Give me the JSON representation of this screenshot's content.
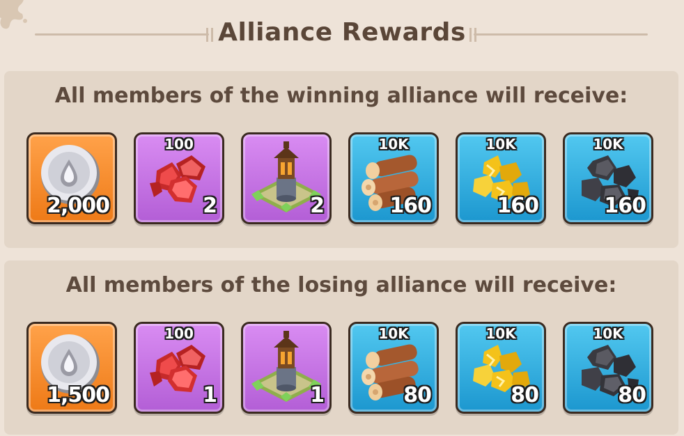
{
  "title": "Alliance Rewards",
  "winning": {
    "heading": "All members of the winning alliance will receive:",
    "rewards": [
      {
        "icon": "silver-coin-icon",
        "badge": "",
        "amount": "2,000"
      },
      {
        "icon": "red-gems-icon",
        "badge": "100",
        "amount": "2"
      },
      {
        "icon": "watchtower-icon",
        "badge": "",
        "amount": "2"
      },
      {
        "icon": "wood-logs-icon",
        "badge": "10K",
        "amount": "160"
      },
      {
        "icon": "gold-ore-icon",
        "badge": "10K",
        "amount": "160"
      },
      {
        "icon": "coal-ore-icon",
        "badge": "10K",
        "amount": "160"
      }
    ]
  },
  "losing": {
    "heading": "All members of the losing alliance will receive:",
    "rewards": [
      {
        "icon": "silver-coin-icon",
        "badge": "",
        "amount": "1,500"
      },
      {
        "icon": "red-gems-icon",
        "badge": "100",
        "amount": "1"
      },
      {
        "icon": "watchtower-icon",
        "badge": "",
        "amount": "1"
      },
      {
        "icon": "wood-logs-icon",
        "badge": "10K",
        "amount": "80"
      },
      {
        "icon": "gold-ore-icon",
        "badge": "10K",
        "amount": "80"
      },
      {
        "icon": "coal-ore-icon",
        "badge": "10K",
        "amount": "80"
      }
    ]
  },
  "colors": {
    "background": "#eee3d8",
    "panel": "#e3d6c8",
    "title": "#5a4638",
    "orange_card": "#ee7a17",
    "purple_card": "#b35ed6",
    "blue_card": "#1c97cf"
  }
}
